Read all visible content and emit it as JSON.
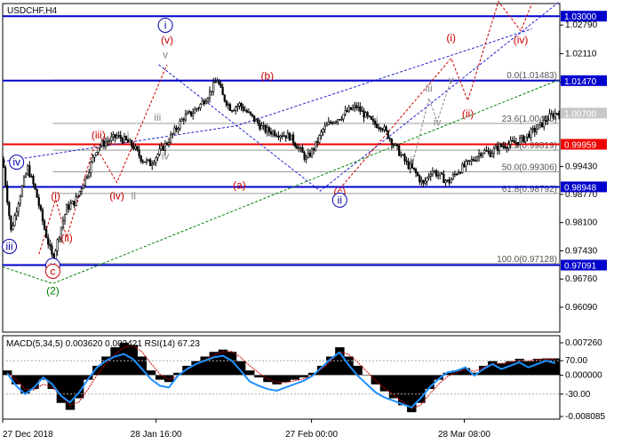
{
  "window": {
    "title": "USDCHF,H4"
  },
  "chart_data": [
    {
      "type": "candlestick",
      "title": "USDCHF,H4",
      "symbol": "USDCHF",
      "timeframe": "H4",
      "ylim": [
        0.955,
        1.033
      ],
      "x_range": [
        "27 Dec 2018",
        "22 Apr 2019"
      ],
      "price_ticks": [
        "1.02790",
        "1.02110",
        "1.01430",
        "0.99430",
        "0.98770",
        "0.98100",
        "0.97430",
        "0.96760",
        "0.96090"
      ],
      "price_tick_values": [
        1.0279,
        1.0211,
        1.0143,
        0.9943,
        0.9877,
        0.981,
        0.9743,
        0.9676,
        0.9609
      ],
      "x_ticks": [
        "27 Dec 2018",
        "28 Jan 16:00",
        "27 Feb 00:00",
        "28 Mar 08:00"
      ],
      "x_tick_positions": [
        0.0,
        0.2754,
        0.5544,
        0.8285
      ],
      "price_path": [
        [
          0.0,
          0.996
        ],
        [
          0.015,
          0.979
        ],
        [
          0.03,
          0.987
        ],
        [
          0.045,
          0.994
        ],
        [
          0.06,
          0.988
        ],
        [
          0.075,
          0.9795
        ],
        [
          0.09,
          0.9722
        ],
        [
          0.105,
          0.98
        ],
        [
          0.115,
          0.9845
        ],
        [
          0.13,
          0.986
        ],
        [
          0.15,
          0.992
        ],
        [
          0.17,
          0.999
        ],
        [
          0.19,
          1.0005
        ],
        [
          0.205,
          1.0015
        ],
        [
          0.22,
          1.0005
        ],
        [
          0.235,
          0.999
        ],
        [
          0.25,
          0.996
        ],
        [
          0.265,
          0.995
        ],
        [
          0.28,
          0.9975
        ],
        [
          0.295,
          1.0
        ],
        [
          0.31,
          1.003
        ],
        [
          0.325,
          1.006
        ],
        [
          0.34,
          1.007
        ],
        [
          0.355,
          1.009
        ],
        [
          0.37,
          1.0115
        ],
        [
          0.385,
          1.015
        ],
        [
          0.395,
          1.011
        ],
        [
          0.41,
          1.008
        ],
        [
          0.425,
          1.009
        ],
        [
          0.44,
          1.007
        ],
        [
          0.455,
          1.005
        ],
        [
          0.47,
          1.003
        ],
        [
          0.485,
          1.0025
        ],
        [
          0.5,
          1.002
        ],
        [
          0.515,
          1.0015
        ],
        [
          0.53,
          0.999
        ],
        [
          0.545,
          0.996
        ],
        [
          0.56,
          0.999
        ],
        [
          0.575,
          1.003
        ],
        [
          0.59,
          1.005
        ],
        [
          0.605,
          1.006
        ],
        [
          0.62,
          1.0075
        ],
        [
          0.635,
          1.0085
        ],
        [
          0.65,
          1.0065
        ],
        [
          0.665,
          1.0045
        ],
        [
          0.68,
          1.004
        ],
        [
          0.695,
          1.001
        ],
        [
          0.71,
          0.998
        ],
        [
          0.725,
          0.995
        ],
        [
          0.74,
          0.993
        ],
        [
          0.755,
          0.99
        ],
        [
          0.77,
          0.9935
        ],
        [
          0.785,
          0.992
        ],
        [
          0.8,
          0.9905
        ],
        [
          0.815,
          0.993
        ],
        [
          0.83,
          0.9945
        ],
        [
          0.845,
          0.996
        ],
        [
          0.86,
          0.998
        ],
        [
          0.875,
          0.9975
        ],
        [
          0.89,
          0.999
        ],
        [
          0.905,
          0.9995
        ],
        [
          0.92,
          1.0
        ],
        [
          0.935,
          1.001
        ],
        [
          0.95,
          1.0025
        ],
        [
          0.965,
          1.004
        ],
        [
          0.98,
          1.006
        ],
        [
          1.0,
          1.0075
        ]
      ],
      "horizontal_levels": [
        {
          "value": 1.03,
          "label": "1.03000",
          "color": "#0000cc",
          "width": "thick"
        },
        {
          "value": 1.0147,
          "label": "1.01470",
          "color": "#0000cc",
          "width": "thick"
        },
        {
          "value": 0.99959,
          "label": "0.99959",
          "color": "#ee0000",
          "width": "thick"
        },
        {
          "value": 0.98948,
          "label": "0.98948",
          "color": "#0000cc",
          "width": "thick"
        },
        {
          "value": 0.97091,
          "label": "0.97091",
          "color": "#0000cc",
          "width": "thick"
        }
      ],
      "current_price": {
        "value": 1.007,
        "label": "1.00700"
      },
      "fibonacci": [
        {
          "text": "0.0(1.01483)",
          "value": 1.01483
        },
        {
          "text": "23.6(1.00455)",
          "value": 1.00455
        },
        {
          "text": "38.2(0.99819)",
          "value": 0.99819
        },
        {
          "text": "50.0(0.99306)",
          "value": 0.99306
        },
        {
          "text": "61.8(0.98792)",
          "value": 0.98792
        },
        {
          "text": "100.0(0.97128)",
          "value": 0.97128
        }
      ],
      "wave_labels": [
        {
          "text": "iv",
          "x": 0.025,
          "y": 0.9945,
          "color": "#0000aa",
          "circled": true
        },
        {
          "text": "iii",
          "x": 0.012,
          "y": 0.9745,
          "color": "#0000aa",
          "circled": true
        },
        {
          "text": "v",
          "x": 0.09,
          "y": 0.97,
          "color": "#0000aa",
          "circled": true
        },
        {
          "text": "c",
          "x": 0.09,
          "y": 0.9686,
          "color": "#cc0000",
          "circled": true
        },
        {
          "text": "(2)",
          "x": 0.09,
          "y": 0.964,
          "color": "#008000",
          "circled": false
        },
        {
          "text": "(i)",
          "x": 0.095,
          "y": 0.9865,
          "color": "#cc0000",
          "circled": false
        },
        {
          "text": "(ii)",
          "x": 0.115,
          "y": 0.9765,
          "color": "#cc0000",
          "circled": false
        },
        {
          "text": "(iii)",
          "x": 0.172,
          "y": 1.001,
          "color": "#cc0000",
          "circled": false
        },
        {
          "text": "(iv)",
          "x": 0.205,
          "y": 0.9865,
          "color": "#cc0000",
          "circled": false
        },
        {
          "text": "ii",
          "x": 0.235,
          "y": 0.9865,
          "color": "#888888",
          "circled": false
        },
        {
          "text": "i",
          "x": 0.225,
          "y": 1.001,
          "color": "#888888",
          "circled": false
        },
        {
          "text": "iii",
          "x": 0.278,
          "y": 1.0052,
          "color": "#888888",
          "circled": false
        },
        {
          "text": "iv",
          "x": 0.292,
          "y": 0.996,
          "color": "#888888",
          "circled": false
        },
        {
          "text": "v",
          "x": 0.292,
          "y": 1.02,
          "color": "#888888",
          "circled": false
        },
        {
          "text": "(v)",
          "x": 0.295,
          "y": 1.0235,
          "color": "#cc0000",
          "circled": false
        },
        {
          "text": "i",
          "x": 0.292,
          "y": 1.027,
          "color": "#0000aa",
          "circled": true
        },
        {
          "text": "(b)",
          "x": 0.475,
          "y": 1.015,
          "color": "#cc0000",
          "circled": false
        },
        {
          "text": "(a)",
          "x": 0.425,
          "y": 0.989,
          "color": "#cc0000",
          "circled": false
        },
        {
          "text": "(c)",
          "x": 0.605,
          "y": 0.9875,
          "color": "#cc0000",
          "circled": false
        },
        {
          "text": "ii",
          "x": 0.605,
          "y": 0.9855,
          "color": "#0000aa",
          "circled": true
        },
        {
          "text": "i",
          "x": 0.672,
          "y": 1.0045,
          "color": "#888888",
          "circled": false
        },
        {
          "text": "ii",
          "x": 0.735,
          "y": 0.995,
          "color": "#888888",
          "circled": false
        },
        {
          "text": "iii",
          "x": 0.765,
          "y": 1.012,
          "color": "#888888",
          "circled": false
        },
        {
          "text": "iv",
          "x": 0.78,
          "y": 1.004,
          "color": "#888888",
          "circled": false
        },
        {
          "text": "v",
          "x": 0.805,
          "y": 1.014,
          "color": "#888888",
          "circled": false
        },
        {
          "text": "(i)",
          "x": 0.805,
          "y": 1.024,
          "color": "#cc0000",
          "circled": false
        },
        {
          "text": "(ii)",
          "x": 0.835,
          "y": 1.006,
          "color": "#cc0000",
          "circled": false
        },
        {
          "text": "(iv)",
          "x": 0.93,
          "y": 1.0235,
          "color": "#cc0000",
          "circled": false
        }
      ],
      "dashed_lines": [
        {
          "color": "#2222cc",
          "points": [
            [
              0.0,
              0.9955
            ],
            [
              0.42,
              1.004
            ],
            [
              0.95,
              1.027
            ]
          ]
        },
        {
          "color": "#2222cc",
          "points": [
            [
              0.28,
              1.0185
            ],
            [
              0.57,
              0.9885
            ],
            [
              1.0,
              1.0335
            ]
          ]
        },
        {
          "color": "#008000",
          "points": [
            [
              0.0,
              0.9705
            ],
            [
              0.09,
              0.9665
            ],
            [
              1.0,
              1.015
            ]
          ]
        },
        {
          "color": "#cc0000",
          "points": [
            [
              0.065,
              0.9735
            ],
            [
              0.095,
              0.9865
            ],
            [
              0.115,
              0.9775
            ],
            [
              0.165,
              0.9995
            ],
            [
              0.205,
              0.9905
            ],
            [
              0.295,
              1.0185
            ]
          ]
        },
        {
          "color": "#cc0000",
          "points": [
            [
              0.605,
              0.989
            ],
            [
              0.805,
              1.02
            ],
            [
              0.835,
              1.01
            ],
            [
              0.89,
              1.0335
            ],
            [
              0.93,
              1.0265
            ],
            [
              0.95,
              1.033
            ]
          ]
        },
        {
          "color": "#888888",
          "points": [
            [
              0.735,
              0.9945
            ],
            [
              0.765,
              1.0105
            ],
            [
              0.78,
              1.005
            ],
            [
              0.805,
              1.015
            ]
          ]
        }
      ]
    },
    {
      "type": "line",
      "title": "MACD(5,34,5) 0.003620 0.003421 RSI(14) 67.23",
      "indicators": [
        {
          "name": "MACD(5,34,5)",
          "values": [
            "0.003620",
            "0.003421"
          ]
        },
        {
          "name": "RSI(14)",
          "value": "67.23"
        }
      ],
      "ylim": [
        -0.0095,
        0.0085
      ],
      "y_ticks": [
        "0.007260",
        "70.00",
        "0.000000",
        "-30.00",
        "-0.008085"
      ],
      "histogram": [
        0.001,
        -0.002,
        -0.004,
        -0.003,
        -0.001,
        -0.003,
        -0.006,
        -0.0075,
        -0.005,
        -0.001,
        0.002,
        0.004,
        0.006,
        0.007,
        0.0065,
        0.004,
        0.001,
        -0.001,
        -0.0015,
        0.0005,
        0.002,
        0.003,
        0.004,
        0.005,
        0.0055,
        0.005,
        0.003,
        0.001,
        -0.0005,
        -0.0015,
        -0.002,
        -0.0015,
        -0.001,
        -0.0005,
        0.0005,
        0.002,
        0.004,
        0.006,
        0.004,
        0.002,
        0.0,
        -0.002,
        -0.0035,
        -0.005,
        -0.0065,
        -0.008,
        -0.006,
        -0.003,
        -0.001,
        0.0005,
        0.001,
        0.0015,
        0.0005,
        0.002,
        0.003,
        0.0025,
        0.003,
        0.0035,
        0.003,
        0.0035,
        0.0036,
        0.0036
      ],
      "signal": [
        0.0005,
        -0.001,
        -0.003,
        -0.0032,
        -0.002,
        -0.0025,
        -0.0045,
        -0.0065,
        -0.0058,
        -0.003,
        0.0,
        0.0025,
        0.0045,
        0.006,
        0.0064,
        0.005,
        0.0025,
        0.0002,
        -0.001,
        -0.0002,
        0.0012,
        0.0023,
        0.0033,
        0.0043,
        0.005,
        0.0051,
        0.0038,
        0.002,
        0.0005,
        -0.0008,
        -0.0016,
        -0.0016,
        -0.0012,
        -0.0008,
        0.0,
        0.0013,
        0.003,
        0.005,
        0.0045,
        0.0028,
        0.0008,
        -0.0012,
        -0.0028,
        -0.0043,
        -0.0057,
        -0.0072,
        -0.0065,
        -0.0042,
        -0.002,
        -0.0003,
        0.0006,
        0.0012,
        0.0008,
        0.0016,
        0.0025,
        0.0025,
        0.0028,
        0.0032,
        0.0031,
        0.0033,
        0.0034,
        0.0034
      ],
      "rsi": [
        55,
        40,
        30,
        38,
        50,
        42,
        28,
        20,
        32,
        48,
        62,
        70,
        75,
        78,
        72,
        60,
        48,
        40,
        38,
        52,
        60,
        66,
        70,
        74,
        76,
        70,
        58,
        45,
        40,
        36,
        34,
        38,
        42,
        46,
        52,
        62,
        72,
        80,
        65,
        52,
        42,
        32,
        26,
        22,
        18,
        14,
        25,
        38,
        48,
        56,
        58,
        62,
        52,
        60,
        66,
        60,
        64,
        68,
        62,
        66,
        70,
        67
      ]
    }
  ]
}
